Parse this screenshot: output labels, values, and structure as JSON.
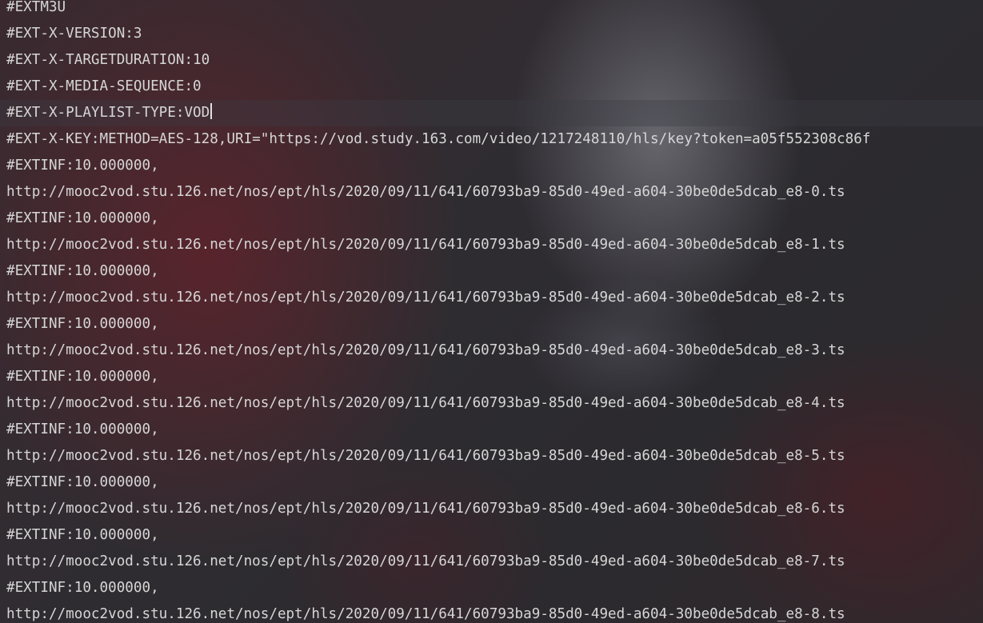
{
  "editor": {
    "current_line_index": 4,
    "lines": [
      "#EXTM3U",
      "#EXT-X-VERSION:3",
      "#EXT-X-TARGETDURATION:10",
      "#EXT-X-MEDIA-SEQUENCE:0",
      "#EXT-X-PLAYLIST-TYPE:VOD",
      "#EXT-X-KEY:METHOD=AES-128,URI=\"https://vod.study.163.com/video/1217248110/hls/key?token=a05f552308c86f",
      "#EXTINF:10.000000,",
      "http://mooc2vod.stu.126.net/nos/ept/hls/2020/09/11/641/60793ba9-85d0-49ed-a604-30be0de5dcab_e8-0.ts",
      "#EXTINF:10.000000,",
      "http://mooc2vod.stu.126.net/nos/ept/hls/2020/09/11/641/60793ba9-85d0-49ed-a604-30be0de5dcab_e8-1.ts",
      "#EXTINF:10.000000,",
      "http://mooc2vod.stu.126.net/nos/ept/hls/2020/09/11/641/60793ba9-85d0-49ed-a604-30be0de5dcab_e8-2.ts",
      "#EXTINF:10.000000,",
      "http://mooc2vod.stu.126.net/nos/ept/hls/2020/09/11/641/60793ba9-85d0-49ed-a604-30be0de5dcab_e8-3.ts",
      "#EXTINF:10.000000,",
      "http://mooc2vod.stu.126.net/nos/ept/hls/2020/09/11/641/60793ba9-85d0-49ed-a604-30be0de5dcab_e8-4.ts",
      "#EXTINF:10.000000,",
      "http://mooc2vod.stu.126.net/nos/ept/hls/2020/09/11/641/60793ba9-85d0-49ed-a604-30be0de5dcab_e8-5.ts",
      "#EXTINF:10.000000,",
      "http://mooc2vod.stu.126.net/nos/ept/hls/2020/09/11/641/60793ba9-85d0-49ed-a604-30be0de5dcab_e8-6.ts",
      "#EXTINF:10.000000,",
      "http://mooc2vod.stu.126.net/nos/ept/hls/2020/09/11/641/60793ba9-85d0-49ed-a604-30be0de5dcab_e8-7.ts",
      "#EXTINF:10.000000,",
      "http://mooc2vod.stu.126.net/nos/ept/hls/2020/09/11/641/60793ba9-85d0-49ed-a604-30be0de5dcab_e8-8.ts"
    ]
  },
  "colors": {
    "text": "#d6d6d6",
    "caret": "#e0e0e0"
  }
}
